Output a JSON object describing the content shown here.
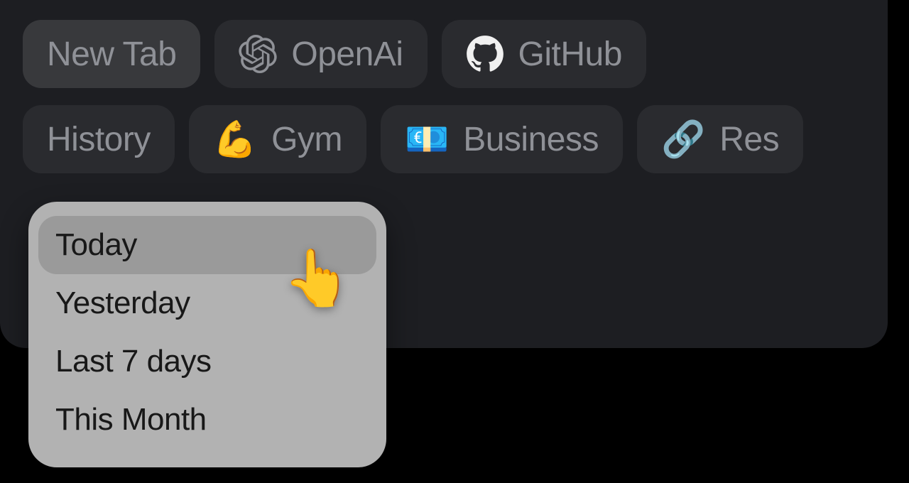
{
  "tabs_row1": [
    {
      "label": "New Tab",
      "icon": null,
      "active": true,
      "name": "tab-new-tab"
    },
    {
      "label": "OpenAi",
      "icon": "openai",
      "active": false,
      "name": "tab-openai"
    },
    {
      "label": "GitHub",
      "icon": "github",
      "active": false,
      "name": "tab-github"
    }
  ],
  "tabs_row2": [
    {
      "label": "History",
      "icon": null,
      "active": false,
      "name": "tab-history"
    },
    {
      "label": "Gym",
      "icon": "flex",
      "active": false,
      "name": "tab-gym"
    },
    {
      "label": "Business",
      "icon": "money",
      "active": false,
      "name": "tab-business"
    },
    {
      "label": "Res",
      "icon": "link",
      "active": false,
      "name": "tab-res"
    }
  ],
  "history_dropdown": {
    "items": [
      {
        "label": "Today",
        "selected": true
      },
      {
        "label": "Yesterday",
        "selected": false
      },
      {
        "label": "Last 7 days",
        "selected": false
      },
      {
        "label": "This Month",
        "selected": false
      }
    ]
  },
  "icons": {
    "flex": "💪",
    "money": "💶",
    "link": "🔗",
    "cursor": "👆"
  }
}
